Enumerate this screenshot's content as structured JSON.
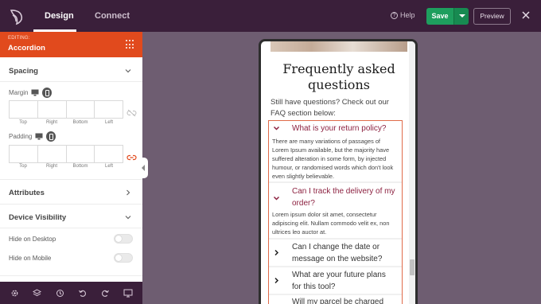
{
  "topbar": {
    "tabs": [
      "Design",
      "Connect"
    ],
    "help_label": "Help",
    "help_glyph": "?",
    "save_label": "Save",
    "preview_label": "Preview"
  },
  "panel": {
    "editing_label": "EDITING:",
    "editing_title": "Accordion",
    "spacing_title": "Spacing",
    "margin_label": "Margin",
    "padding_label": "Padding",
    "sides": [
      "Top",
      "Right",
      "Bottom",
      "Left"
    ],
    "attributes_title": "Attributes",
    "device_visibility_title": "Device Visibility",
    "hide_desktop_label": "Hide on Desktop",
    "hide_desktop_on": false,
    "hide_mobile_label": "Hide on Mobile",
    "hide_mobile_on": false
  },
  "bottombar": {
    "icons": [
      "settings-icon",
      "layers-icon",
      "history-icon",
      "undo-icon",
      "redo-icon",
      "desktop-preview-icon"
    ]
  },
  "preview": {
    "title": "Frequently asked questions",
    "subtitle": "Still have questions? Check out our FAQ section below:",
    "faq": [
      {
        "question": "What is your return policy?",
        "open": true,
        "answer": "There are many variations of passages of Lorem Ipsum available, but the majority have suffered alteration in some form, by injected humour, or randomised words which don't look even slightly believable."
      },
      {
        "question": "Can I track the delivery of my order?",
        "open": true,
        "answer": "Lorem ipsum dolor sit amet, consectetur adipiscing elit. Nullam commodo velit ex, non ultrices leo auctor at."
      },
      {
        "question": "Can I change the date or message on the website?",
        "open": false
      },
      {
        "question": "What are your future plans for this tool?",
        "open": false
      },
      {
        "question": "Will my parcel be charged",
        "open": false
      }
    ]
  },
  "colors": {
    "topbar": "#3a1f3a",
    "accent_orange": "#e14a1d",
    "save_green": "#1e9e5e",
    "canvas": "#6e5d71",
    "question_open": "#8c2140"
  }
}
